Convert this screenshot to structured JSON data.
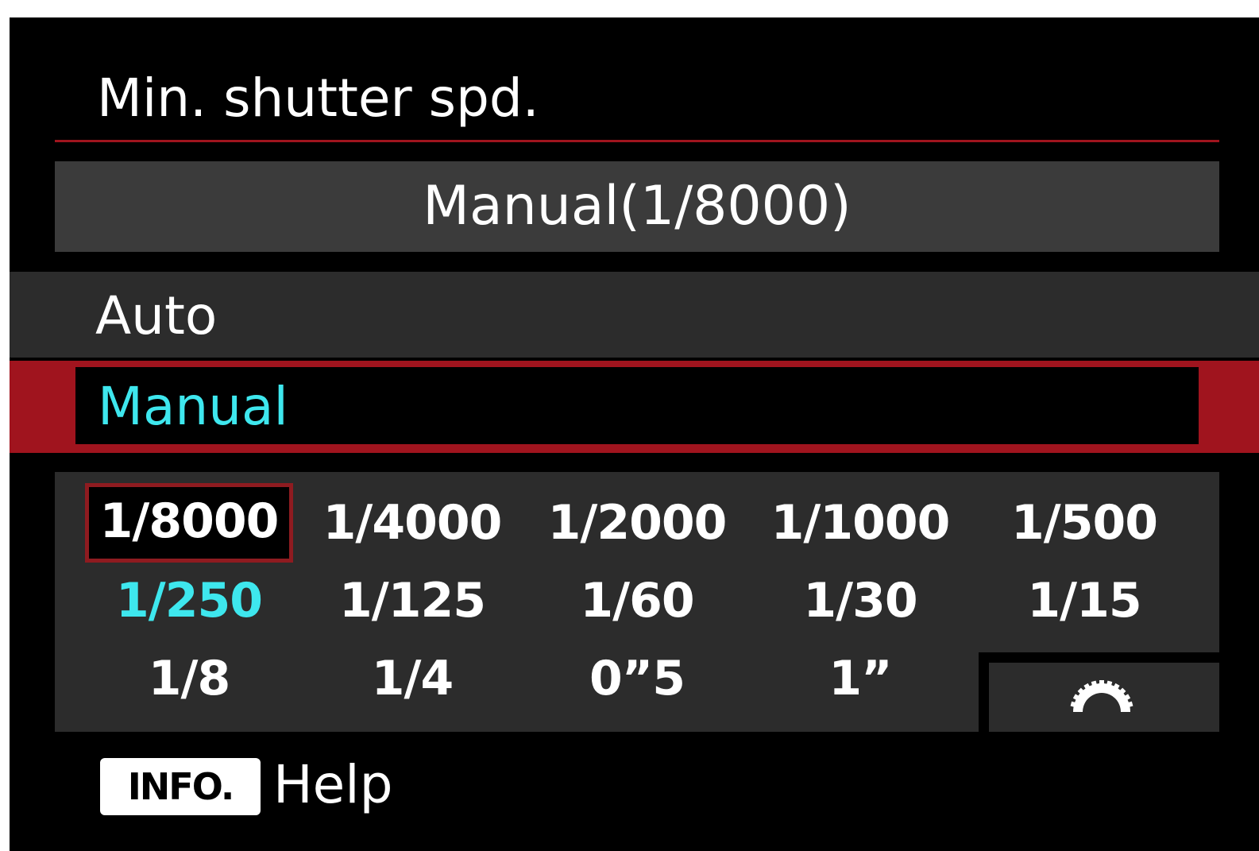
{
  "menu": {
    "title": "Min. shutter spd.",
    "current_setting": "Manual(1/8000)"
  },
  "options": [
    {
      "label": "Auto",
      "state": "normal"
    },
    {
      "label": "Manual",
      "state": "highlighted"
    }
  ],
  "shutter_values": [
    [
      "1/8000",
      "1/4000",
      "1/2000",
      "1/1000",
      "1/500"
    ],
    [
      "1/250",
      "1/125",
      "1/60",
      "1/30",
      "1/15"
    ],
    [
      "1/8",
      "1/4",
      "0”5",
      "1”"
    ]
  ],
  "selected_value": "1/8000",
  "dial_icon": "main-dial-icon",
  "footer": {
    "info_button": "INFO.",
    "help_label": "Help"
  },
  "colors": {
    "accent_red": "#a0141e",
    "highlight_cyan": "#3ee7ee",
    "panel_gray": "#2c2c2c",
    "bar_gray": "#3b3b3b"
  }
}
